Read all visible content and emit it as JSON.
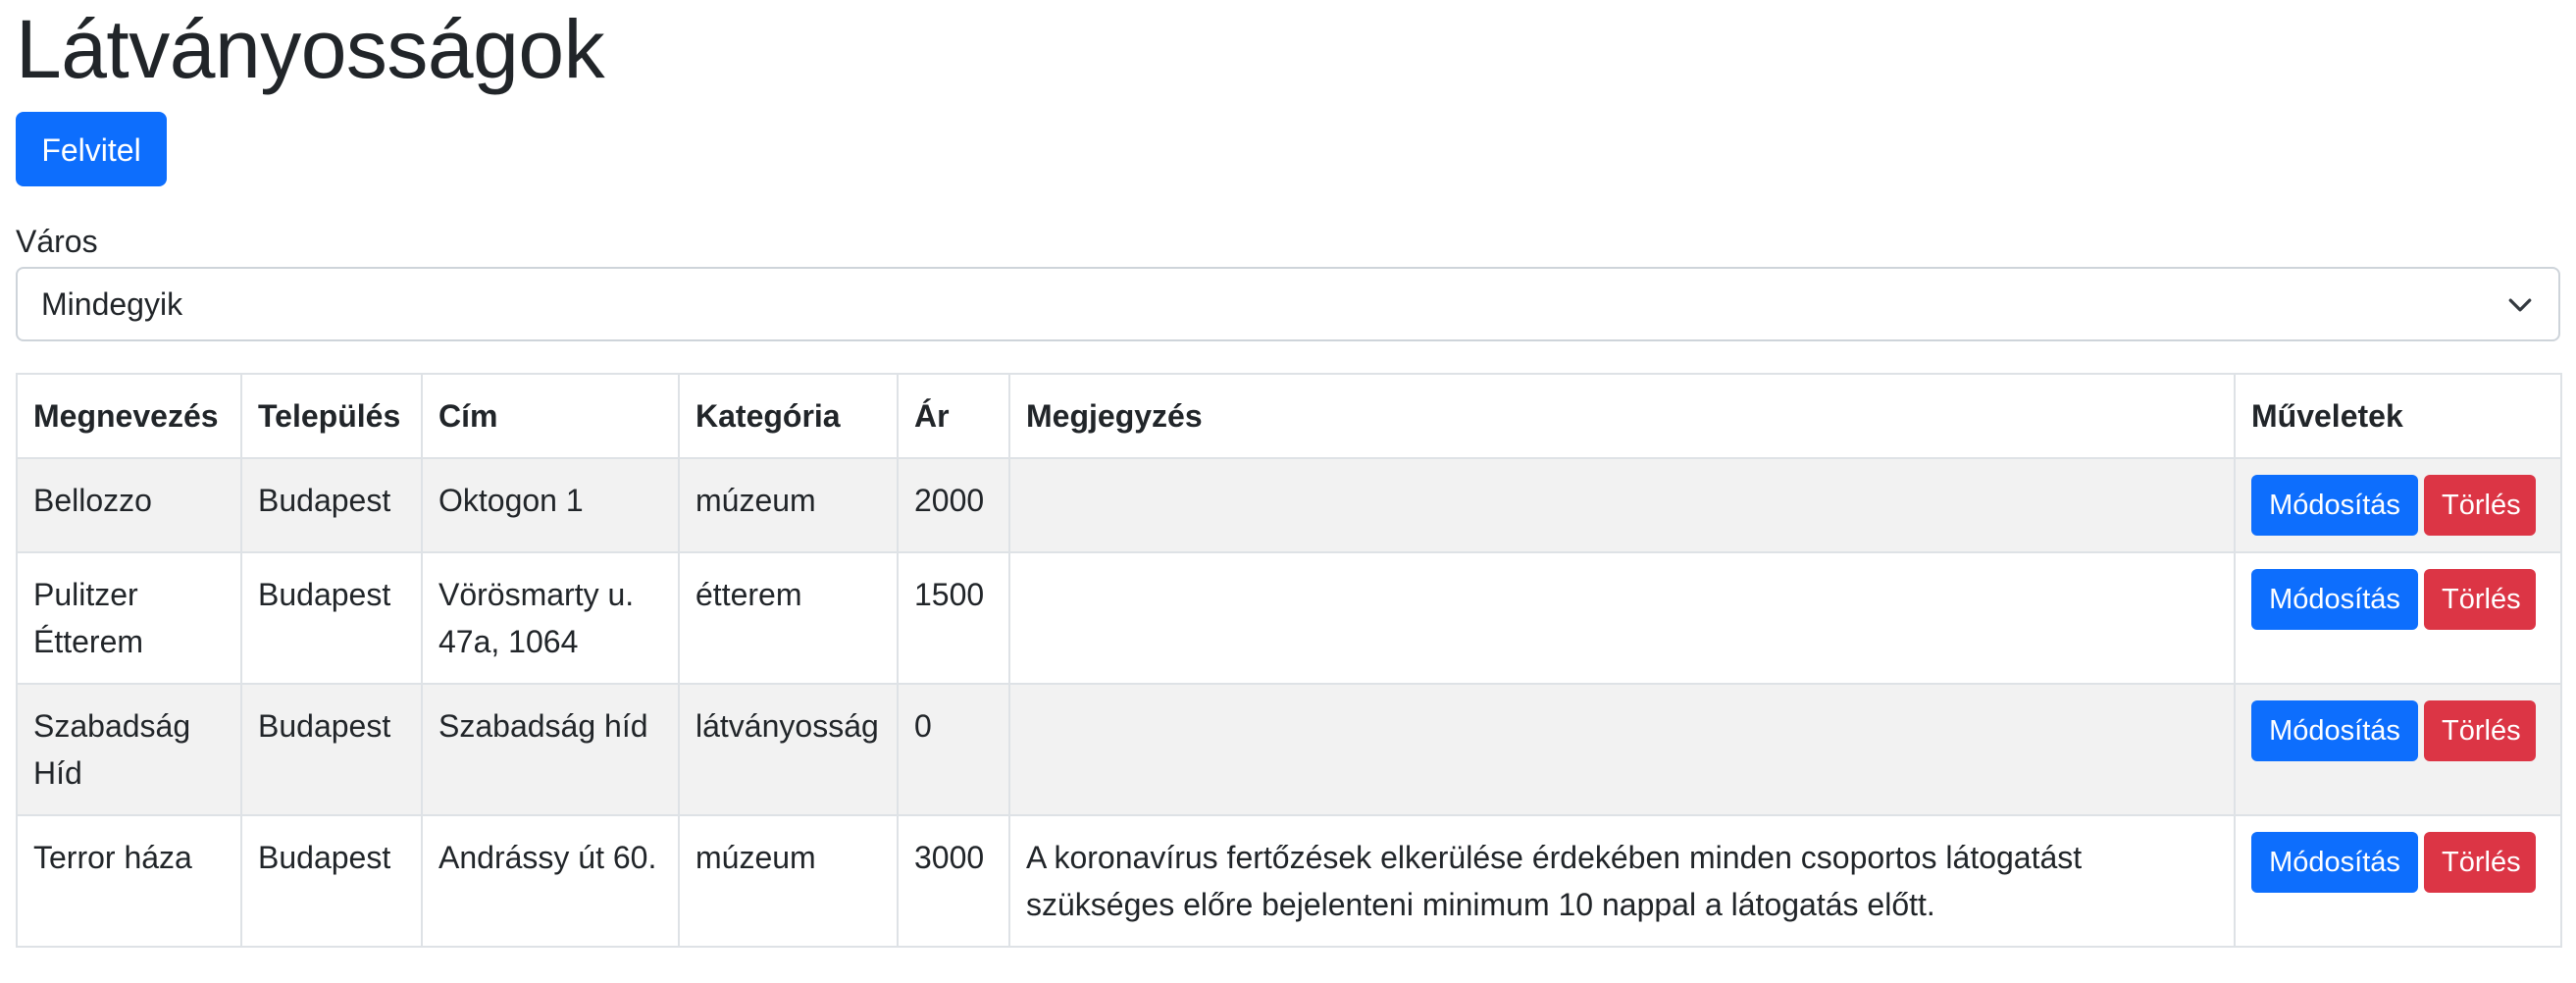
{
  "page": {
    "title": "Látványosságok"
  },
  "toolbar": {
    "add_label": "Felvitel"
  },
  "filter": {
    "label": "Város",
    "selected": "Mindegyik"
  },
  "table": {
    "columns": [
      "Megnevezés",
      "Település",
      "Cím",
      "Kategória",
      "Ár",
      "Megjegyzés",
      "Műveletek"
    ],
    "edit_label": "Módosítás",
    "delete_label": "Törlés",
    "rows": [
      {
        "name": "Bellozzo",
        "city": "Budapest",
        "address": "Oktogon 1",
        "category": "múzeum",
        "price": "2000",
        "note": ""
      },
      {
        "name": "Pulitzer Étterem",
        "city": "Budapest",
        "address": "Vörösmarty u. 47a, 1064",
        "category": "étterem",
        "price": "1500",
        "note": ""
      },
      {
        "name": "Szabadság Híd",
        "city": "Budapest",
        "address": "Szabadság híd",
        "category": "látványosság",
        "price": "0",
        "note": ""
      },
      {
        "name": "Terror háza",
        "city": "Budapest",
        "address": "Andrássy út 60.",
        "category": "múzeum",
        "price": "3000",
        "note": "A koronavírus fertőzések elkerülése érdekében minden csoportos látogatást szükséges előre bejelenteni minimum 10 nappal a látogatás előtt."
      }
    ]
  },
  "colors": {
    "primary": "#0d6efd",
    "danger": "#dc3545",
    "stripe": "#f2f2f2",
    "border": "#dee2e6"
  },
  "icons": {
    "select_chevron": "chevron-down-icon"
  }
}
